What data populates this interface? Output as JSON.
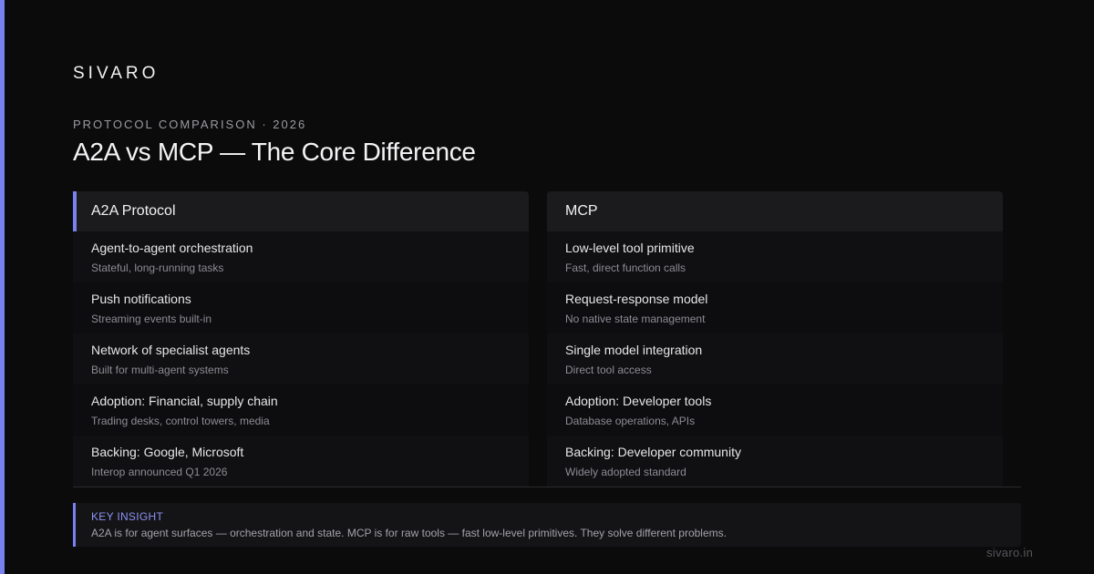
{
  "brand": "SIVARO",
  "eyebrow": "PROTOCOL COMPARISON · 2026",
  "title": "A2A vs MCP — The Core Difference",
  "accent_color": "#7b80f0",
  "columns": [
    {
      "heading": "A2A Protocol",
      "rows": [
        {
          "main": "Agent-to-agent orchestration",
          "sub": "Stateful, long-running tasks"
        },
        {
          "main": "Push notifications",
          "sub": "Streaming events built-in"
        },
        {
          "main": "Network of specialist agents",
          "sub": "Built for multi-agent systems"
        },
        {
          "main": "Adoption: Financial, supply chain",
          "sub": "Trading desks, control towers, media"
        },
        {
          "main": "Backing: Google, Microsoft",
          "sub": "Interop announced Q1 2026"
        }
      ]
    },
    {
      "heading": "MCP",
      "rows": [
        {
          "main": "Low-level tool primitive",
          "sub": "Fast, direct function calls"
        },
        {
          "main": "Request-response model",
          "sub": "No native state management"
        },
        {
          "main": "Single model integration",
          "sub": "Direct tool access"
        },
        {
          "main": "Adoption: Developer tools",
          "sub": "Database operations, APIs"
        },
        {
          "main": "Backing: Developer community",
          "sub": "Widely adopted standard"
        }
      ]
    }
  ],
  "insight": {
    "label": "KEY INSIGHT",
    "text": "A2A is for agent surfaces — orchestration and state. MCP is for raw tools — fast low-level primitives. They solve different problems."
  },
  "footer": "sivaro.in"
}
